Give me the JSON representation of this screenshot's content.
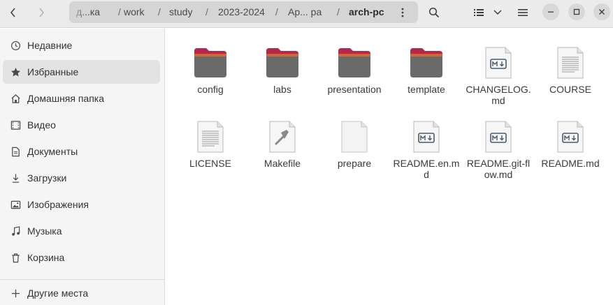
{
  "header": {
    "breadcrumbs": [
      "д...ка",
      "work",
      "study",
      "2023-2024",
      "Ар... ра",
      "arch-pc"
    ],
    "separator": "/"
  },
  "sidebar": {
    "items": [
      {
        "label": "Недавние",
        "icon": "recent-icon"
      },
      {
        "label": "Избранные",
        "icon": "star-icon"
      },
      {
        "label": "Домашняя папка",
        "icon": "home-icon"
      },
      {
        "label": "Видео",
        "icon": "video-icon"
      },
      {
        "label": "Документы",
        "icon": "documents-icon"
      },
      {
        "label": "Загрузки",
        "icon": "downloads-icon"
      },
      {
        "label": "Изображения",
        "icon": "pictures-icon"
      },
      {
        "label": "Музыка",
        "icon": "music-icon"
      },
      {
        "label": "Корзина",
        "icon": "trash-icon"
      }
    ],
    "other": {
      "label": "Другие места",
      "icon": "plus-icon"
    }
  },
  "files": [
    {
      "name": "config",
      "type": "folder"
    },
    {
      "name": "labs",
      "type": "folder"
    },
    {
      "name": "presentation",
      "type": "folder"
    },
    {
      "name": "template",
      "type": "folder"
    },
    {
      "name": "CHANGELOG.md",
      "type": "markdown"
    },
    {
      "name": "COURSE",
      "type": "text"
    },
    {
      "name": "LICENSE",
      "type": "text"
    },
    {
      "name": "Makefile",
      "type": "makefile"
    },
    {
      "name": "prepare",
      "type": "blank"
    },
    {
      "name": "README.en.md",
      "type": "markdown"
    },
    {
      "name": "README.git-flow.md",
      "type": "markdown"
    },
    {
      "name": "README.md",
      "type": "markdown"
    }
  ],
  "colors": {
    "folder_tab": "#b5284a",
    "folder_body": "#6a6a6a",
    "accent": "#e95420"
  }
}
